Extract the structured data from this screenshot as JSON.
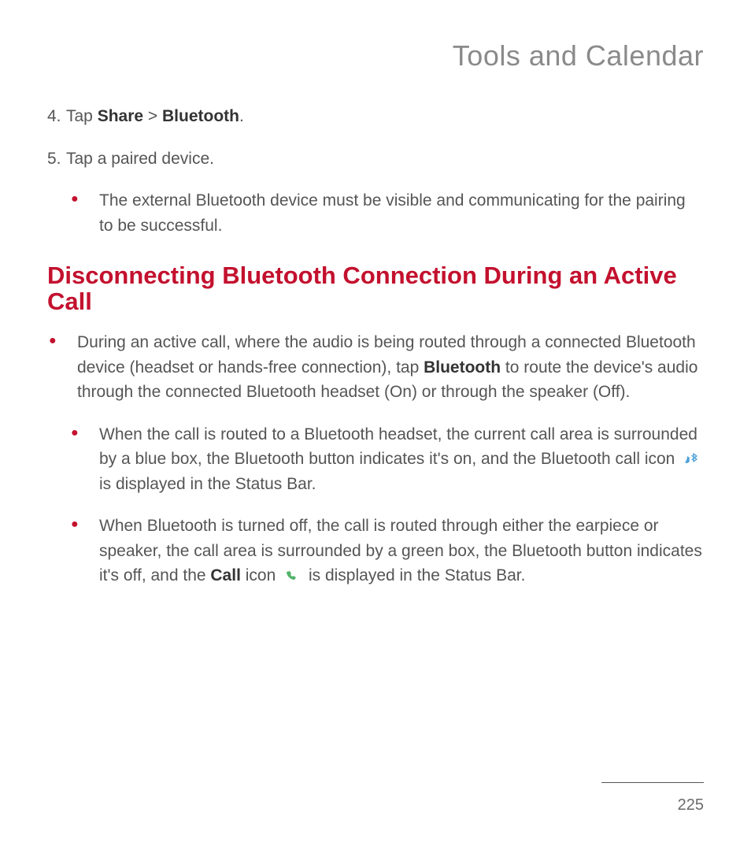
{
  "header": {
    "title": "Tools and Calendar"
  },
  "steps": {
    "step4": {
      "num": "4.",
      "pre": "Tap ",
      "share": "Share",
      "sep": " > ",
      "bluetooth": "Bluetooth",
      "post": "."
    },
    "step5": {
      "num": "5.",
      "text": "Tap a paired device."
    }
  },
  "note1": "The external Bluetooth device must be visible and communicating for the pairing to be successful.",
  "section_title": "Disconnecting Bluetooth Connection During an Active Call",
  "main_bullet": {
    "pre": "During an active call, where the audio is being routed through a connected Bluetooth device (headset or hands-free connection), tap ",
    "bold": "Bluetooth",
    "post": " to route the device's audio through the connected Bluetooth headset (On) or through the speaker (Off)."
  },
  "sub_bullet_1": {
    "pre": "When the call is routed to a Bluetooth headset, the current call area is surrounded by a blue box, the Bluetooth button indicates it's on, and the Bluetooth call icon ",
    "post": " is displayed in the Status Bar."
  },
  "sub_bullet_2": {
    "pre": "When Bluetooth is turned off, the call is routed through either the earpiece or speaker, the call area is surrounded by a green box, the Bluetooth button indicates it's off, and the ",
    "bold": "Call",
    "mid": " icon ",
    "post": " is displayed in the Status Bar."
  },
  "page_number": "225",
  "colors": {
    "accent": "#c3112e"
  },
  "icons": {
    "bluetooth_call": "bluetooth-call-icon",
    "call": "call-icon"
  }
}
